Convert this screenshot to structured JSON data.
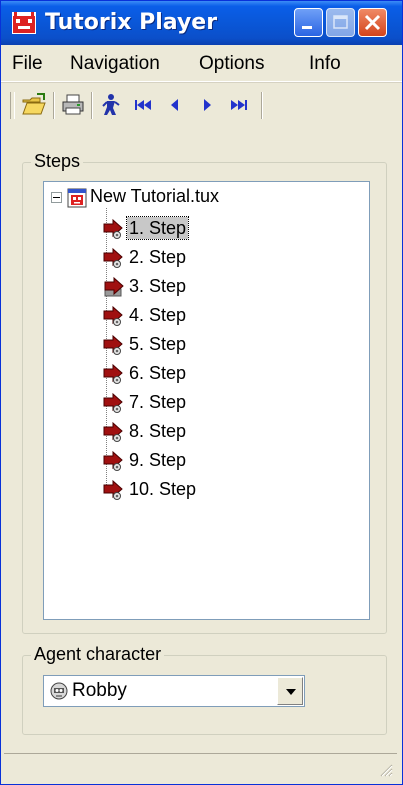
{
  "window": {
    "title": "Tutorix Player"
  },
  "menu": [
    "File",
    "Navigation",
    "Options",
    "Info"
  ],
  "toolbar_icons": [
    "open-folder-icon",
    "print-icon",
    "agent-icon",
    "first-step-icon",
    "previous-step-icon",
    "next-step-icon",
    "last-step-icon"
  ],
  "steps_group": {
    "label": "Steps",
    "root": "New Tutorial.tux",
    "items": [
      {
        "label": "1. Step",
        "selected": true,
        "icon": "step-arrow-icon"
      },
      {
        "label": "2. Step",
        "selected": false,
        "icon": "step-arrow-icon"
      },
      {
        "label": "3. Step",
        "selected": false,
        "icon": "step-arrow-disabled-icon"
      },
      {
        "label": "4. Step",
        "selected": false,
        "icon": "step-arrow-icon"
      },
      {
        "label": "5. Step",
        "selected": false,
        "icon": "step-arrow-icon"
      },
      {
        "label": "6. Step",
        "selected": false,
        "icon": "step-arrow-icon"
      },
      {
        "label": "7. Step",
        "selected": false,
        "icon": "step-arrow-icon"
      },
      {
        "label": "8. Step",
        "selected": false,
        "icon": "step-arrow-icon"
      },
      {
        "label": "9. Step",
        "selected": false,
        "icon": "step-arrow-icon"
      },
      {
        "label": "10. Step",
        "selected": false,
        "icon": "step-arrow-icon"
      }
    ]
  },
  "agent_group": {
    "label": "Agent character",
    "value": "Robby"
  },
  "colors": {
    "title_bar": "#0a5ee8",
    "window_bg": "#ece9d8",
    "step_arrow": "#a01010",
    "selection": "#c8c8c8"
  }
}
